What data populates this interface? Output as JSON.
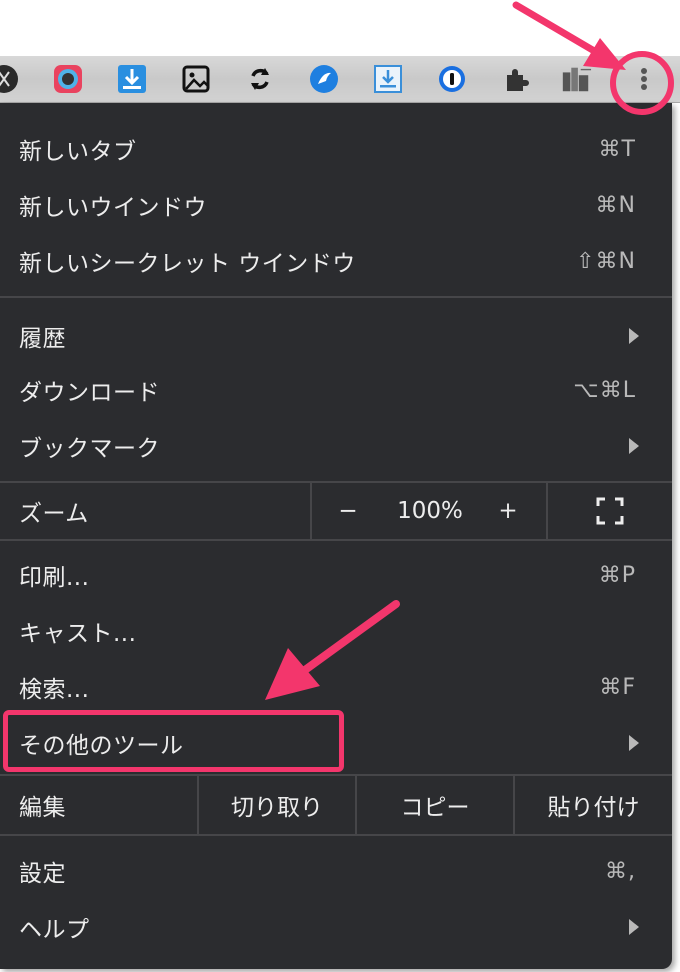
{
  "toolbar": {
    "icons": [
      {
        "name": "scissors-extension-icon"
      },
      {
        "name": "color-picker-extension-icon"
      },
      {
        "name": "download-extension-icon"
      },
      {
        "name": "image-extension-icon"
      },
      {
        "name": "sync-extension-icon"
      },
      {
        "name": "note-extension-icon"
      },
      {
        "name": "save-extension-icon"
      },
      {
        "name": "password-manager-extension-icon"
      },
      {
        "name": "extensions-puzzle-icon"
      },
      {
        "name": "city-extension-icon"
      },
      {
        "name": "more-menu-icon"
      }
    ]
  },
  "menu": {
    "new_tab": {
      "label": "新しいタブ",
      "shortcut": "⌘T"
    },
    "new_window": {
      "label": "新しいウインドウ",
      "shortcut": "⌘N"
    },
    "new_incognito": {
      "label": "新しいシークレット ウインドウ",
      "shortcut": "⇧⌘N"
    },
    "history": {
      "label": "履歴"
    },
    "downloads": {
      "label": "ダウンロード",
      "shortcut": "⌥⌘L"
    },
    "bookmarks": {
      "label": "ブックマーク"
    },
    "zoom": {
      "label": "ズーム",
      "minus": "−",
      "value": "100%",
      "plus": "+"
    },
    "print": {
      "label": "印刷...",
      "shortcut": "⌘P"
    },
    "cast": {
      "label": "キャスト..."
    },
    "find": {
      "label": "検索...",
      "shortcut": "⌘F"
    },
    "more_tools": {
      "label": "その他のツール"
    },
    "edit": {
      "label": "編集",
      "cut": "切り取り",
      "copy": "コピー",
      "paste": "貼り付け"
    },
    "settings": {
      "label": "設定",
      "shortcut": "⌘,"
    },
    "help": {
      "label": "ヘルプ"
    }
  },
  "annotation": {
    "color": "#f3366c"
  }
}
